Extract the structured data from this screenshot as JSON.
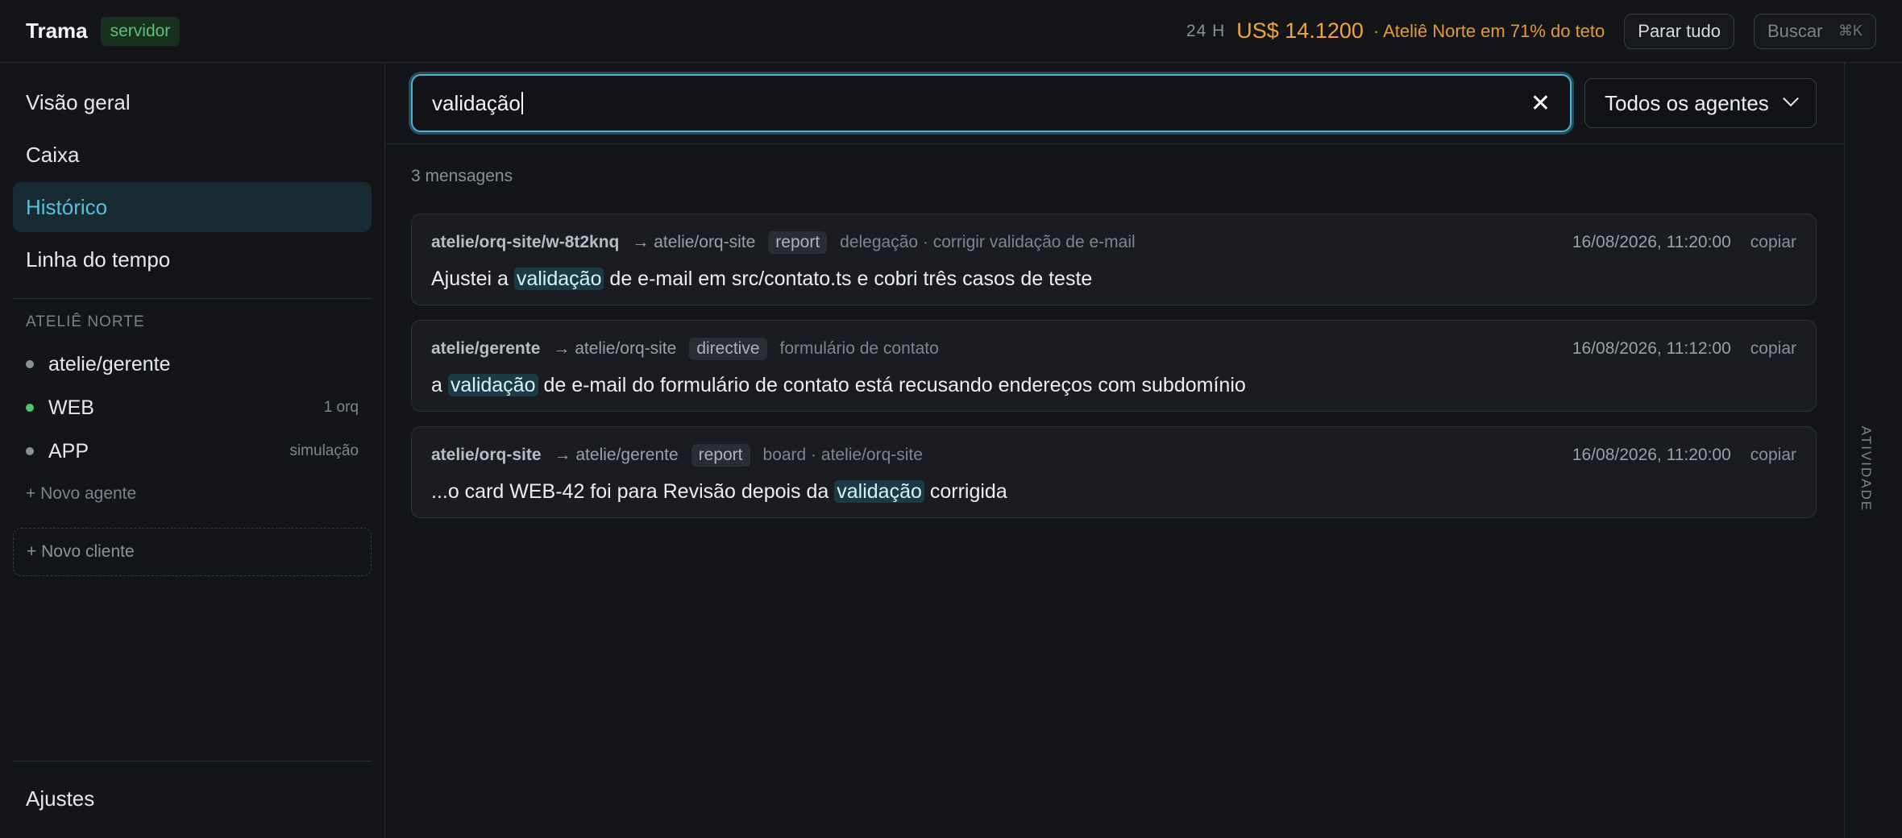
{
  "app": {
    "title": "Trama",
    "env_badge": "servidor"
  },
  "header": {
    "period": "24 H",
    "cost": "US$ 14.1200",
    "budget_note": "· Ateliê Norte em 71% do teto",
    "stop_all": "Parar tudo",
    "search": {
      "label": "Buscar",
      "shortcut": "⌘K"
    }
  },
  "colors": {
    "accent": "#56c0dc",
    "cost": "#f0a33a",
    "env_badge": "#5fbf7a",
    "online_dot": "#4cc46a",
    "highlight_bg": "#1c3a44"
  },
  "sidebar": {
    "nav": [
      {
        "label": "Visão geral",
        "active": false
      },
      {
        "label": "Caixa",
        "active": false
      },
      {
        "label": "Histórico",
        "active": true
      },
      {
        "label": "Linha do tempo",
        "active": false
      }
    ],
    "section_label": "ATELIÊ NORTE",
    "agents": [
      {
        "name": "atelie/gerente",
        "tag": "",
        "status": "idle"
      },
      {
        "name": "WEB",
        "tag": "1 orq",
        "status": "online"
      },
      {
        "name": "APP",
        "tag": "simulação",
        "status": "idle"
      }
    ],
    "new_agent": "+ Novo agente",
    "new_client": "+ Novo cliente",
    "settings": "Ajustes"
  },
  "search": {
    "query": "validação",
    "agent_filter": "Todos os agentes"
  },
  "results": {
    "count_label": "3 mensagens",
    "copy_label": "copiar",
    "messages": [
      {
        "from": "atelie/orq-site/w-8t2knq",
        "to": "→ atelie/orq-site",
        "type": "report",
        "context": "delegação · corrigir validação de e-mail",
        "timestamp": "16/08/2026, 11:20:00",
        "text_before": "Ajustei a ",
        "highlight": "validação",
        "text_after": " de e-mail em src/contato.ts e cobri três casos de teste"
      },
      {
        "from": "atelie/gerente",
        "to": "→ atelie/orq-site",
        "type": "directive",
        "context": "formulário de contato",
        "timestamp": "16/08/2026, 11:12:00",
        "text_before": "a ",
        "highlight": "validação",
        "text_after": " de e-mail do formulário de contato está recusando endereços com subdomínio"
      },
      {
        "from": "atelie/orq-site",
        "to": "→ atelie/gerente",
        "type": "report",
        "context": "board · atelie/orq-site",
        "timestamp": "16/08/2026, 11:20:00",
        "text_before": "...o card WEB-42 foi para Revisão depois da ",
        "highlight": "validação",
        "text_after": " corrigida"
      }
    ]
  },
  "activity_rail": {
    "label": "ATIVIDADE"
  }
}
